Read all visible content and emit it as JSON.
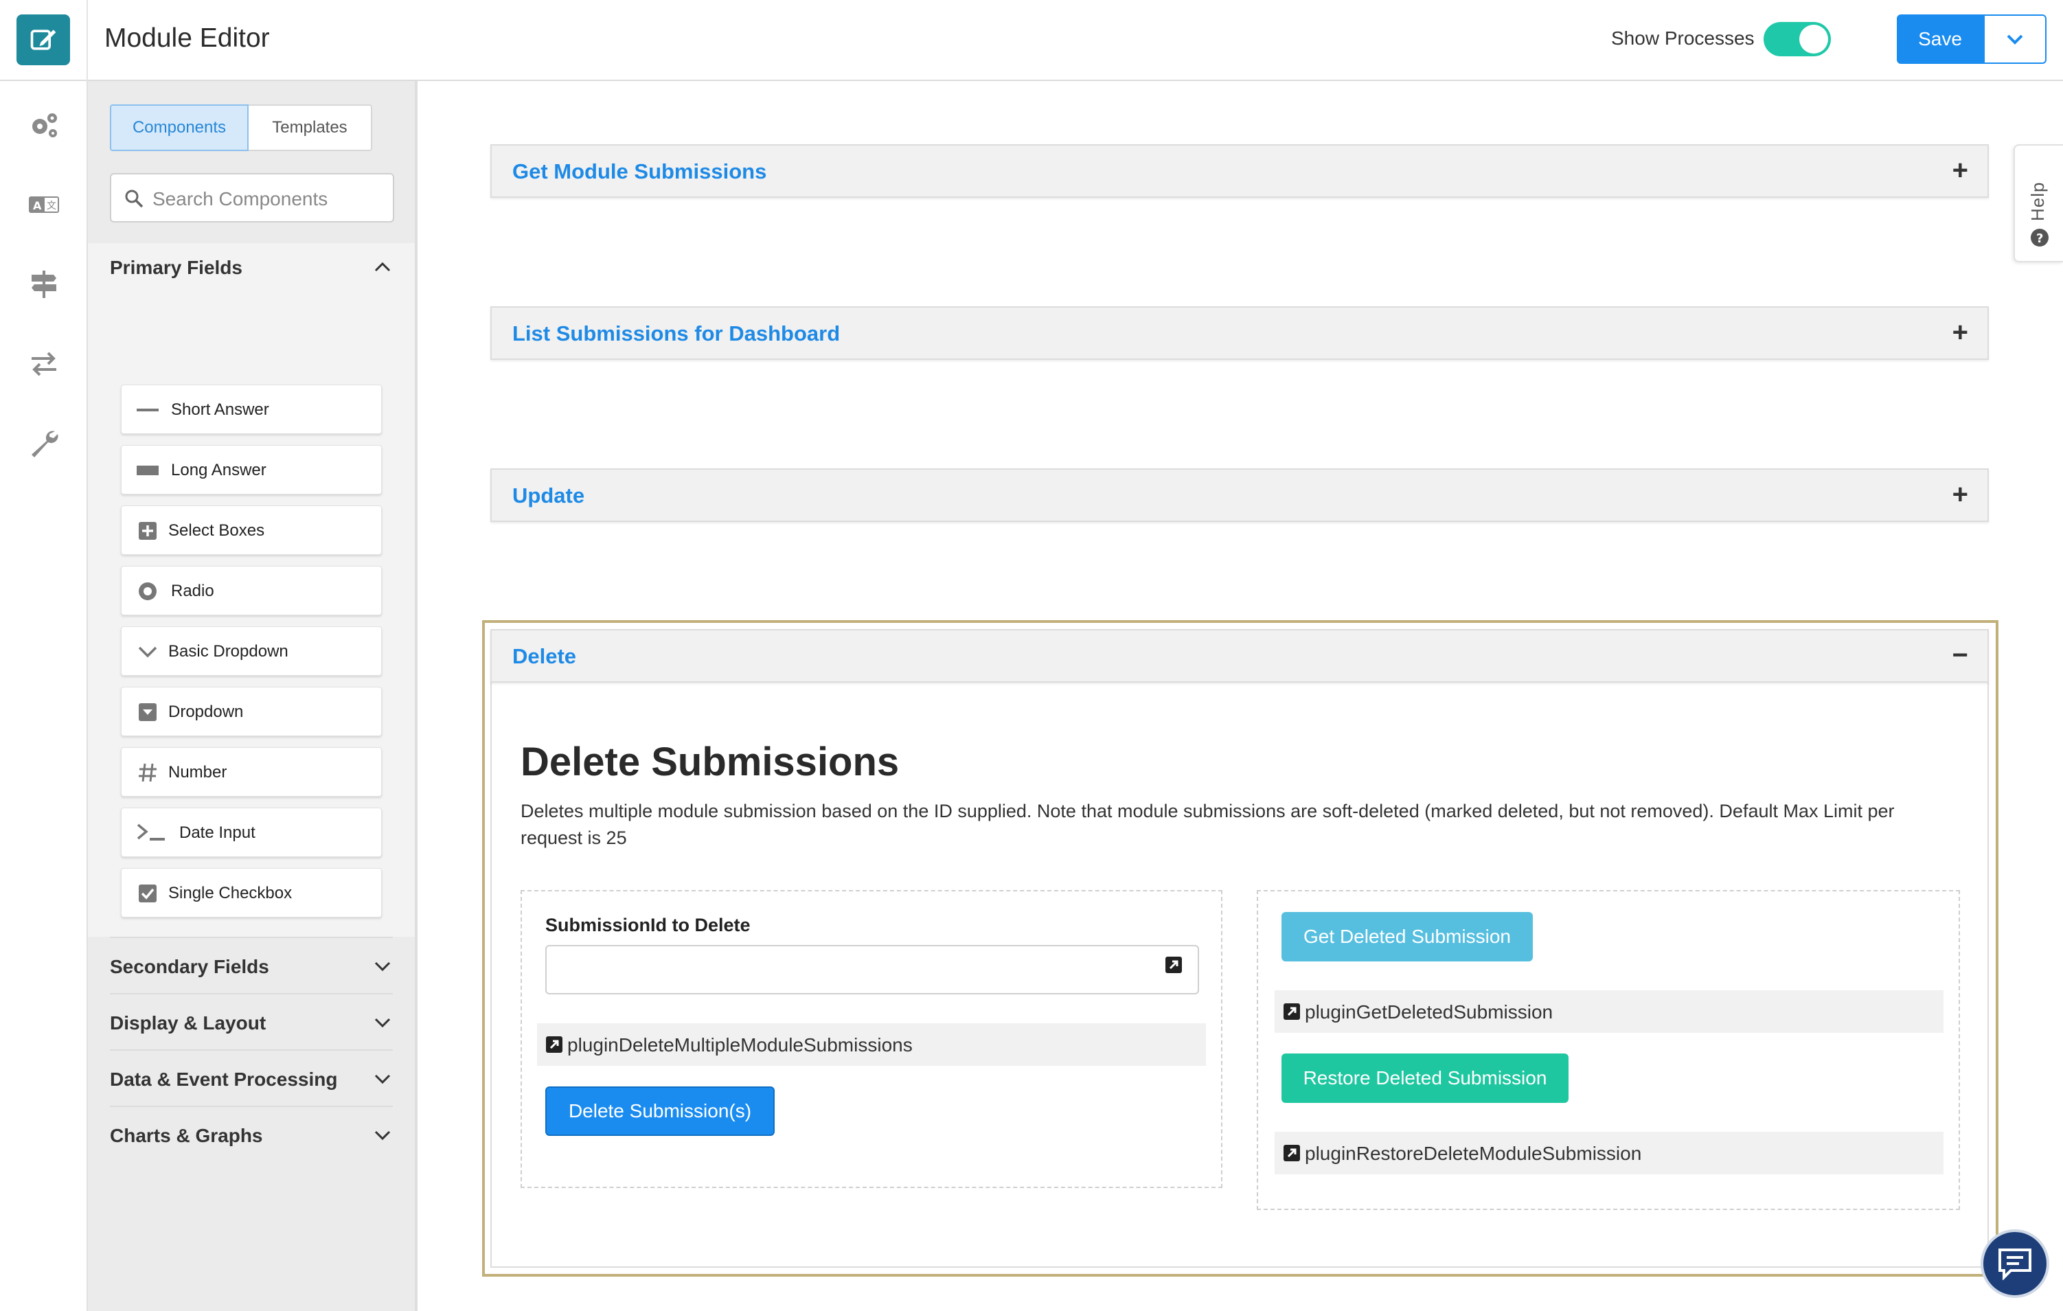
{
  "header": {
    "title": "Module Editor",
    "show_processes_label": "Show Processes",
    "show_processes_on": true,
    "save_label": "Save"
  },
  "colors": {
    "accent_blue": "#1a8cf0",
    "teal": "#1fc7a0",
    "logo_bg": "#1f8a9c",
    "link_blue": "#1e8ae6",
    "active_outline": "#c2b07a"
  },
  "rail": {
    "icons": [
      "edit-icon",
      "gears-icon",
      "translate-icon",
      "signpost-icon",
      "exchange-icon",
      "wrench-icon"
    ]
  },
  "panel": {
    "tabs": [
      "Components",
      "Templates"
    ],
    "search_placeholder": "Search Components",
    "primary_section": "Primary Fields",
    "components": [
      {
        "label": "Short Answer",
        "icon": "short-answer-icon"
      },
      {
        "label": "Long Answer",
        "icon": "long-answer-icon"
      },
      {
        "label": "Select Boxes",
        "icon": "plus-square-icon"
      },
      {
        "label": "Radio",
        "icon": "radio-icon"
      },
      {
        "label": "Basic Dropdown",
        "icon": "chevron-down-icon"
      },
      {
        "label": "Dropdown",
        "icon": "dropdown-square-icon"
      },
      {
        "label": "Number",
        "icon": "hash-icon"
      },
      {
        "label": "Date Input",
        "icon": "terminal-icon"
      },
      {
        "label": "Single Checkbox",
        "icon": "checkbox-icon"
      }
    ],
    "other_sections": [
      "Secondary Fields",
      "Display & Layout",
      "Data & Event Processing",
      "Charts & Graphs"
    ]
  },
  "main": {
    "sections": [
      {
        "title": "Get Module Submissions",
        "sign": "+"
      },
      {
        "title": "List Submissions for Dashboard",
        "sign": "+"
      },
      {
        "title": "Update",
        "sign": "+"
      },
      {
        "title": "Delete",
        "sign": "−"
      }
    ],
    "delete": {
      "heading": "Delete Submissions",
      "description": "Deletes multiple module submission based on the ID supplied. Note that module submissions are soft-deleted (marked deleted, but not removed). Default Max Limit per request is 25",
      "field_label": "SubmissionId to Delete",
      "field_value": "",
      "left_plugin": "pluginDeleteMultipleModuleSubmissions",
      "delete_button": "Delete Submission(s)",
      "get_deleted_button": "Get Deleted Submission",
      "get_deleted_plugin": "pluginGetDeletedSubmission",
      "restore_button": "Restore Deleted Submission",
      "restore_plugin": "pluginRestoreDeleteModuleSubmission"
    }
  },
  "help": {
    "label": "Help"
  }
}
